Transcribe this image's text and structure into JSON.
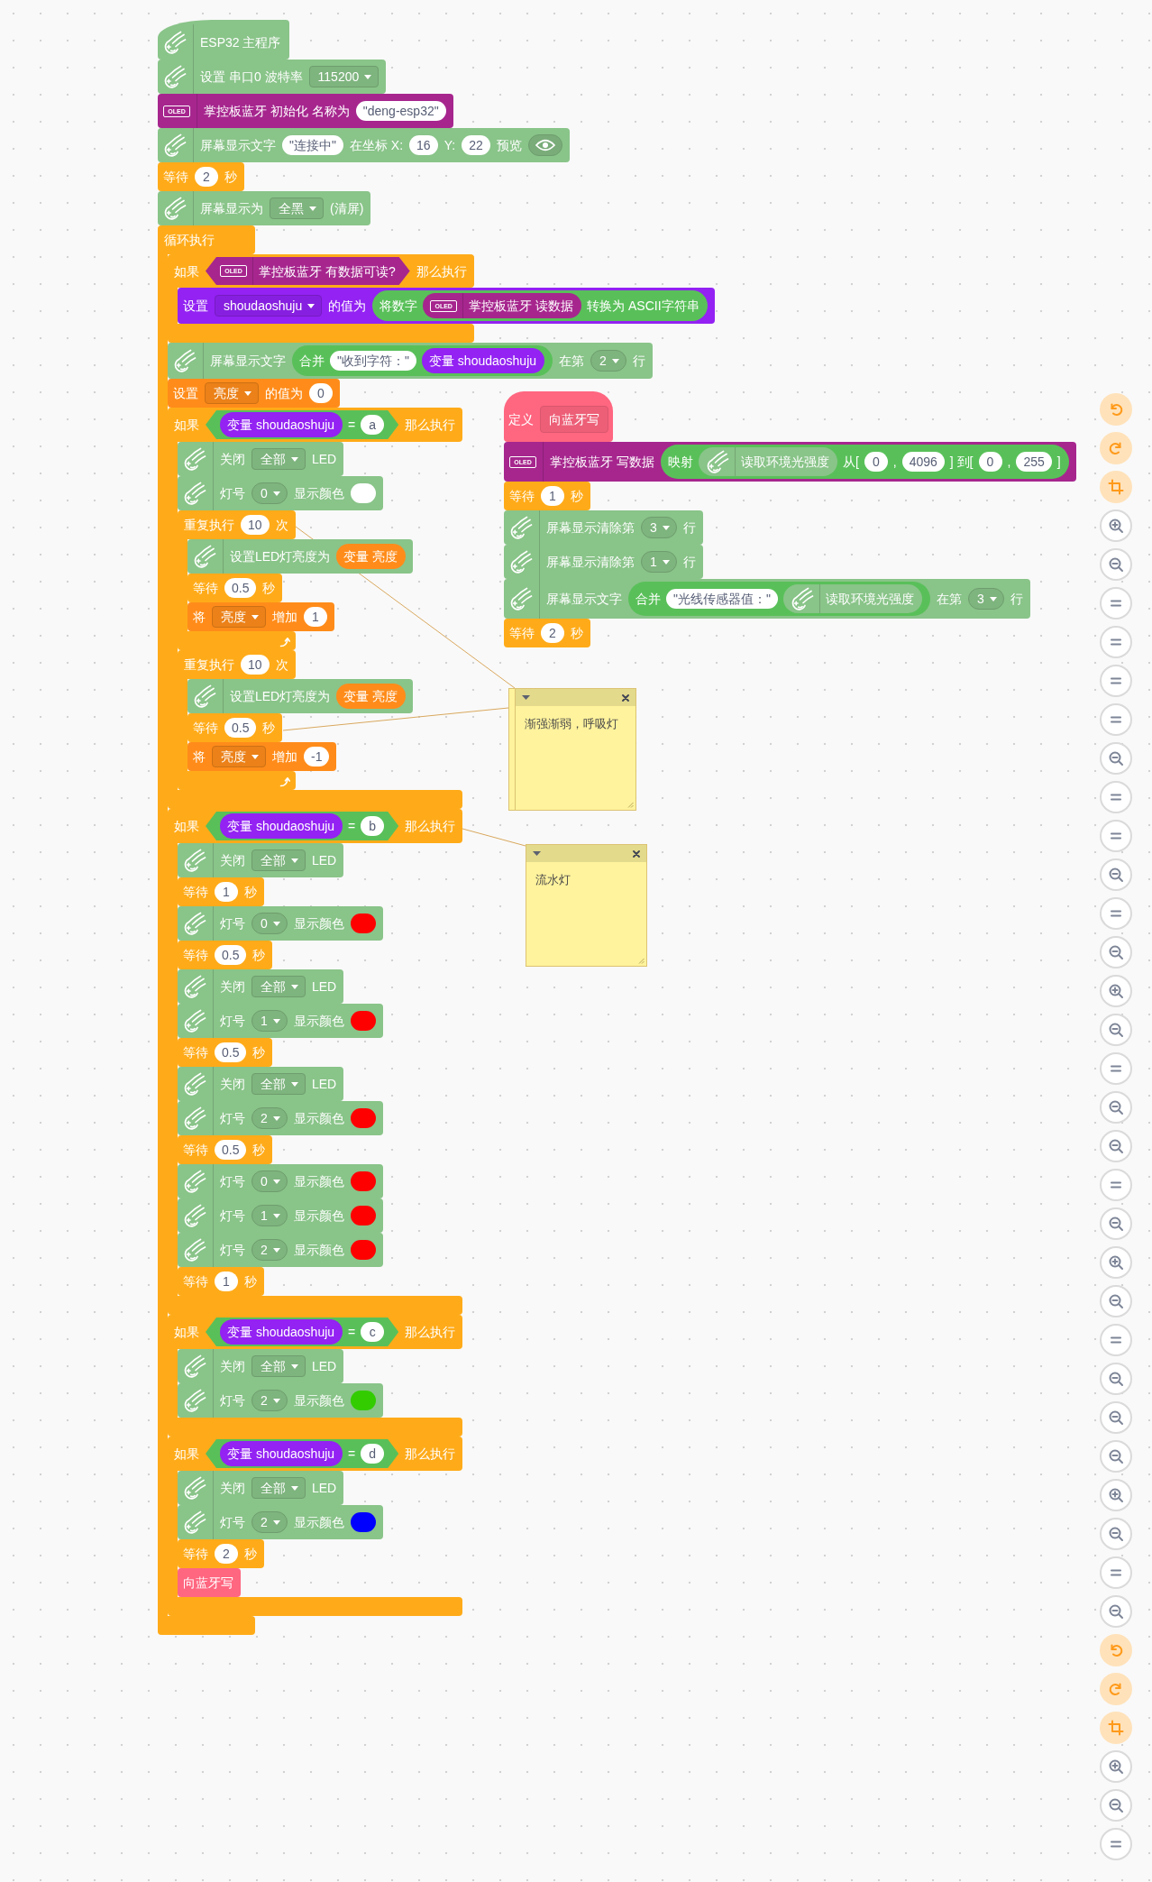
{
  "workspace": {
    "stacks": [
      {
        "blocks": [
          {
            "kind": "hat",
            "color": "#89c489",
            "parts": [
              {
                "kind": "icon"
              },
              {
                "kind": "label",
                "text": "ESP32 主程序"
              }
            ]
          },
          {
            "kind": "statement",
            "color": "#89c489",
            "parts": [
              {
                "kind": "icon"
              },
              {
                "kind": "label",
                "text": "设置 串口0 波特率"
              },
              {
                "kind": "dropdown",
                "text": "115200"
              }
            ]
          },
          {
            "kind": "statement",
            "color": "#a6268e",
            "parts": [
              {
                "kind": "tag",
                "text": "OLED"
              },
              {
                "kind": "label",
                "text": "掌控板蓝牙 初始化 名称为"
              },
              {
                "kind": "input",
                "text": "\"deng-esp32\""
              }
            ]
          },
          {
            "kind": "statement",
            "color": "#89c489",
            "parts": [
              {
                "kind": "icon"
              },
              {
                "kind": "label",
                "text": "屏幕显示文字"
              },
              {
                "kind": "input",
                "text": "\"连接中\""
              },
              {
                "kind": "label",
                "text": "在坐标 X:"
              },
              {
                "kind": "input",
                "text": "16"
              },
              {
                "kind": "label",
                "text": "Y:"
              },
              {
                "kind": "input",
                "text": "22"
              },
              {
                "kind": "label",
                "text": "预览"
              },
              {
                "kind": "eye_button"
              }
            ]
          },
          {
            "kind": "statement",
            "color": "#ffab19",
            "parts": [
              {
                "kind": "label",
                "text": "等待"
              },
              {
                "kind": "input",
                "text": "2"
              },
              {
                "kind": "label",
                "text": "秒"
              }
            ]
          },
          {
            "kind": "statement",
            "color": "#89c489",
            "parts": [
              {
                "kind": "icon"
              },
              {
                "kind": "label",
                "text": "屏幕显示为"
              },
              {
                "kind": "dropdown",
                "text": "全黑"
              },
              {
                "kind": "label",
                "text": "(清屏)"
              }
            ]
          },
          {
            "kind": "forever",
            "color": "#ffab19",
            "parts": [
              {
                "kind": "label",
                "text": "循环执行"
              }
            ],
            "body": [
              {
                "kind": "if",
                "color": "#ffab19",
                "parts": [
                  {
                    "kind": "label",
                    "text": "如果"
                  },
                  {
                    "kind": "boolean",
                    "color": "#a6268e",
                    "parts": [
                      {
                        "kind": "tag",
                        "text": "OLED"
                      },
                      {
                        "kind": "label",
                        "text": "掌控板蓝牙 有数据可读?"
                      }
                    ]
                  },
                  {
                    "kind": "label",
                    "text": "那么执行"
                  }
                ],
                "body": [
                  {
                    "kind": "statement",
                    "color": "#9322f3",
                    "parts": [
                      {
                        "kind": "label",
                        "text": "设置"
                      },
                      {
                        "kind": "dropdown",
                        "text": "shoudaoshuju"
                      },
                      {
                        "kind": "label",
                        "text": "的值为"
                      },
                      {
                        "kind": "reporter",
                        "color": "#59c059",
                        "parts": [
                          {
                            "kind": "label",
                            "text": "将数字"
                          },
                          {
                            "kind": "reporter",
                            "color": "#a6268e",
                            "parts": [
                              {
                                "kind": "tag",
                                "text": "OLED"
                              },
                              {
                                "kind": "label",
                                "text": "掌控板蓝牙 读数据"
                              }
                            ]
                          },
                          {
                            "kind": "label",
                            "text": "转换为 ASCII字符串"
                          }
                        ]
                      }
                    ]
                  }
                ]
              },
              {
                "kind": "statement",
                "color": "#89c489",
                "parts": [
                  {
                    "kind": "icon"
                  },
                  {
                    "kind": "label",
                    "text": "屏幕显示文字"
                  },
                  {
                    "kind": "reporter",
                    "color": "#59c059",
                    "parts": [
                      {
                        "kind": "label",
                        "text": "合并"
                      },
                      {
                        "kind": "input",
                        "text": "\"收到字符：\""
                      },
                      {
                        "kind": "reporter",
                        "color": "#9322f3",
                        "parts": [
                          {
                            "kind": "label",
                            "text": "变量 shoudaoshuju"
                          }
                        ]
                      }
                    ]
                  },
                  {
                    "kind": "label",
                    "text": "在第"
                  },
                  {
                    "kind": "pill_dropdown",
                    "text": "2"
                  },
                  {
                    "kind": "label",
                    "text": "行"
                  }
                ]
              },
              {
                "kind": "statement",
                "color": "#ff8c1a",
                "parts": [
                  {
                    "kind": "label",
                    "text": "设置"
                  },
                  {
                    "kind": "dropdown",
                    "text": "亮度"
                  },
                  {
                    "kind": "label",
                    "text": "的值为"
                  },
                  {
                    "kind": "input",
                    "text": "0"
                  }
                ]
              },
              {
                "kind": "if",
                "color": "#ffab19",
                "parts": [
                  {
                    "kind": "label",
                    "text": "如果"
                  },
                  {
                    "kind": "boolean",
                    "color": "#59c059",
                    "parts": [
                      {
                        "kind": "reporter",
                        "color": "#9322f3",
                        "parts": [
                          {
                            "kind": "label",
                            "text": "变量 shoudaoshuju"
                          }
                        ]
                      },
                      {
                        "kind": "label",
                        "text": "="
                      },
                      {
                        "kind": "input",
                        "text": "a"
                      }
                    ]
                  },
                  {
                    "kind": "label",
                    "text": "那么执行"
                  }
                ],
                "body": [
                  {
                    "kind": "statement",
                    "color": "#89c489",
                    "parts": [
                      {
                        "kind": "icon"
                      },
                      {
                        "kind": "label",
                        "text": "关闭"
                      },
                      {
                        "kind": "dropdown",
                        "text": "全部"
                      },
                      {
                        "kind": "label",
                        "text": "LED"
                      }
                    ]
                  },
                  {
                    "kind": "statement",
                    "color": "#89c489",
                    "parts": [
                      {
                        "kind": "icon"
                      },
                      {
                        "kind": "label",
                        "text": "灯号"
                      },
                      {
                        "kind": "pill_dropdown",
                        "text": "0"
                      },
                      {
                        "kind": "label",
                        "text": "显示颜色"
                      },
                      {
                        "kind": "swatch",
                        "color": "#ffffff"
                      }
                    ]
                  },
                  {
                    "kind": "repeat",
                    "color": "#ffab19",
                    "commented": true,
                    "parts": [
                      {
                        "kind": "label",
                        "text": "重复执行"
                      },
                      {
                        "kind": "input",
                        "text": "10"
                      },
                      {
                        "kind": "label",
                        "text": "次"
                      }
                    ],
                    "body": [
                      {
                        "kind": "statement",
                        "color": "#89c489",
                        "parts": [
                          {
                            "kind": "icon"
                          },
                          {
                            "kind": "label",
                            "text": "设置LED灯亮度为"
                          },
                          {
                            "kind": "reporter",
                            "color": "#ff8c1a",
                            "parts": [
                              {
                                "kind": "label",
                                "text": "变量 亮度"
                              }
                            ]
                          }
                        ]
                      },
                      {
                        "kind": "statement",
                        "color": "#ffab19",
                        "parts": [
                          {
                            "kind": "label",
                            "text": "等待"
                          },
                          {
                            "kind": "input",
                            "text": "0.5"
                          },
                          {
                            "kind": "label",
                            "text": "秒"
                          }
                        ]
                      },
                      {
                        "kind": "statement",
                        "color": "#ff8c1a",
                        "parts": [
                          {
                            "kind": "label",
                            "text": "将"
                          },
                          {
                            "kind": "dropdown",
                            "text": "亮度"
                          },
                          {
                            "kind": "label",
                            "text": "增加"
                          },
                          {
                            "kind": "input",
                            "text": "1"
                          }
                        ]
                      }
                    ]
                  },
                  {
                    "kind": "repeat",
                    "color": "#ffab19",
                    "parts": [
                      {
                        "kind": "label",
                        "text": "重复执行"
                      },
                      {
                        "kind": "input",
                        "text": "10"
                      },
                      {
                        "kind": "label",
                        "text": "次"
                      }
                    ],
                    "body": [
                      {
                        "kind": "statement",
                        "color": "#89c489",
                        "parts": [
                          {
                            "kind": "icon"
                          },
                          {
                            "kind": "label",
                            "text": "设置LED灯亮度为"
                          },
                          {
                            "kind": "reporter",
                            "color": "#ff8c1a",
                            "parts": [
                              {
                                "kind": "label",
                                "text": "变量 亮度"
                              }
                            ]
                          }
                        ]
                      },
                      {
                        "kind": "statement",
                        "color": "#ffab19",
                        "commented": true,
                        "parts": [
                          {
                            "kind": "label",
                            "text": "等待"
                          },
                          {
                            "kind": "input",
                            "text": "0.5"
                          },
                          {
                            "kind": "label",
                            "text": "秒"
                          }
                        ]
                      },
                      {
                        "kind": "statement",
                        "color": "#ff8c1a",
                        "parts": [
                          {
                            "kind": "label",
                            "text": "将"
                          },
                          {
                            "kind": "dropdown",
                            "text": "亮度"
                          },
                          {
                            "kind": "label",
                            "text": "增加"
                          },
                          {
                            "kind": "input",
                            "text": "-1"
                          }
                        ]
                      }
                    ]
                  }
                ]
              },
              {
                "kind": "if",
                "color": "#ffab19",
                "commented": true,
                "parts": [
                  {
                    "kind": "label",
                    "text": "如果"
                  },
                  {
                    "kind": "boolean",
                    "color": "#59c059",
                    "parts": [
                      {
                        "kind": "reporter",
                        "color": "#9322f3",
                        "parts": [
                          {
                            "kind": "label",
                            "text": "变量 shoudaoshuju"
                          }
                        ]
                      },
                      {
                        "kind": "label",
                        "text": "="
                      },
                      {
                        "kind": "input",
                        "text": "b"
                      }
                    ]
                  },
                  {
                    "kind": "label",
                    "text": "那么执行"
                  }
                ],
                "body": [
                  {
                    "kind": "statement",
                    "color": "#89c489",
                    "parts": [
                      {
                        "kind": "icon"
                      },
                      {
                        "kind": "label",
                        "text": "关闭"
                      },
                      {
                        "kind": "dropdown",
                        "text": "全部"
                      },
                      {
                        "kind": "label",
                        "text": "LED"
                      }
                    ]
                  },
                  {
                    "kind": "statement",
                    "color": "#ffab19",
                    "parts": [
                      {
                        "kind": "label",
                        "text": "等待"
                      },
                      {
                        "kind": "input",
                        "text": "1"
                      },
                      {
                        "kind": "label",
                        "text": "秒"
                      }
                    ]
                  },
                  {
                    "kind": "statement",
                    "color": "#89c489",
                    "parts": [
                      {
                        "kind": "icon"
                      },
                      {
                        "kind": "label",
                        "text": "灯号"
                      },
                      {
                        "kind": "pill_dropdown",
                        "text": "0"
                      },
                      {
                        "kind": "label",
                        "text": "显示颜色"
                      },
                      {
                        "kind": "swatch",
                        "color": "#ff0000"
                      }
                    ]
                  },
                  {
                    "kind": "statement",
                    "color": "#ffab19",
                    "parts": [
                      {
                        "kind": "label",
                        "text": "等待"
                      },
                      {
                        "kind": "input",
                        "text": "0.5"
                      },
                      {
                        "kind": "label",
                        "text": "秒"
                      }
                    ]
                  },
                  {
                    "kind": "statement",
                    "color": "#89c489",
                    "parts": [
                      {
                        "kind": "icon"
                      },
                      {
                        "kind": "label",
                        "text": "关闭"
                      },
                      {
                        "kind": "dropdown",
                        "text": "全部"
                      },
                      {
                        "kind": "label",
                        "text": "LED"
                      }
                    ]
                  },
                  {
                    "kind": "statement",
                    "color": "#89c489",
                    "parts": [
                      {
                        "kind": "icon"
                      },
                      {
                        "kind": "label",
                        "text": "灯号"
                      },
                      {
                        "kind": "pill_dropdown",
                        "text": "1"
                      },
                      {
                        "kind": "label",
                        "text": "显示颜色"
                      },
                      {
                        "kind": "swatch",
                        "color": "#ff0000"
                      }
                    ]
                  },
                  {
                    "kind": "statement",
                    "color": "#ffab19",
                    "parts": [
                      {
                        "kind": "label",
                        "text": "等待"
                      },
                      {
                        "kind": "input",
                        "text": "0.5"
                      },
                      {
                        "kind": "label",
                        "text": "秒"
                      }
                    ]
                  },
                  {
                    "kind": "statement",
                    "color": "#89c489",
                    "parts": [
                      {
                        "kind": "icon"
                      },
                      {
                        "kind": "label",
                        "text": "关闭"
                      },
                      {
                        "kind": "dropdown",
                        "text": "全部"
                      },
                      {
                        "kind": "label",
                        "text": "LED"
                      }
                    ]
                  },
                  {
                    "kind": "statement",
                    "color": "#89c489",
                    "parts": [
                      {
                        "kind": "icon"
                      },
                      {
                        "kind": "label",
                        "text": "灯号"
                      },
                      {
                        "kind": "pill_dropdown",
                        "text": "2"
                      },
                      {
                        "kind": "label",
                        "text": "显示颜色"
                      },
                      {
                        "kind": "swatch",
                        "color": "#ff0000"
                      }
                    ]
                  },
                  {
                    "kind": "statement",
                    "color": "#ffab19",
                    "parts": [
                      {
                        "kind": "label",
                        "text": "等待"
                      },
                      {
                        "kind": "input",
                        "text": "0.5"
                      },
                      {
                        "kind": "label",
                        "text": "秒"
                      }
                    ]
                  },
                  {
                    "kind": "statement",
                    "color": "#89c489",
                    "parts": [
                      {
                        "kind": "icon"
                      },
                      {
                        "kind": "label",
                        "text": "灯号"
                      },
                      {
                        "kind": "pill_dropdown",
                        "text": "0"
                      },
                      {
                        "kind": "label",
                        "text": "显示颜色"
                      },
                      {
                        "kind": "swatch",
                        "color": "#ff0000"
                      }
                    ]
                  },
                  {
                    "kind": "statement",
                    "color": "#89c489",
                    "parts": [
                      {
                        "kind": "icon"
                      },
                      {
                        "kind": "label",
                        "text": "灯号"
                      },
                      {
                        "kind": "pill_dropdown",
                        "text": "1"
                      },
                      {
                        "kind": "label",
                        "text": "显示颜色"
                      },
                      {
                        "kind": "swatch",
                        "color": "#ff0000"
                      }
                    ]
                  },
                  {
                    "kind": "statement",
                    "color": "#89c489",
                    "parts": [
                      {
                        "kind": "icon"
                      },
                      {
                        "kind": "label",
                        "text": "灯号"
                      },
                      {
                        "kind": "pill_dropdown",
                        "text": "2"
                      },
                      {
                        "kind": "label",
                        "text": "显示颜色"
                      },
                      {
                        "kind": "swatch",
                        "color": "#ff0000"
                      }
                    ]
                  },
                  {
                    "kind": "statement",
                    "color": "#ffab19",
                    "parts": [
                      {
                        "kind": "label",
                        "text": "等待"
                      },
                      {
                        "kind": "input",
                        "text": "1"
                      },
                      {
                        "kind": "label",
                        "text": "秒"
                      }
                    ]
                  }
                ]
              },
              {
                "kind": "if",
                "color": "#ffab19",
                "parts": [
                  {
                    "kind": "label",
                    "text": "如果"
                  },
                  {
                    "kind": "boolean",
                    "color": "#59c059",
                    "parts": [
                      {
                        "kind": "reporter",
                        "color": "#9322f3",
                        "parts": [
                          {
                            "kind": "label",
                            "text": "变量 shoudaoshuju"
                          }
                        ]
                      },
                      {
                        "kind": "label",
                        "text": "="
                      },
                      {
                        "kind": "input",
                        "text": "c"
                      }
                    ]
                  },
                  {
                    "kind": "label",
                    "text": "那么执行"
                  }
                ],
                "body": [
                  {
                    "kind": "statement",
                    "color": "#89c489",
                    "parts": [
                      {
                        "kind": "icon"
                      },
                      {
                        "kind": "label",
                        "text": "关闭"
                      },
                      {
                        "kind": "dropdown",
                        "text": "全部"
                      },
                      {
                        "kind": "label",
                        "text": "LED"
                      }
                    ]
                  },
                  {
                    "kind": "statement",
                    "color": "#89c489",
                    "parts": [
                      {
                        "kind": "icon"
                      },
                      {
                        "kind": "label",
                        "text": "灯号"
                      },
                      {
                        "kind": "pill_dropdown",
                        "text": "2"
                      },
                      {
                        "kind": "label",
                        "text": "显示颜色"
                      },
                      {
                        "kind": "swatch",
                        "color": "#33cc00"
                      }
                    ]
                  }
                ]
              },
              {
                "kind": "if",
                "color": "#ffab19",
                "parts": [
                  {
                    "kind": "label",
                    "text": "如果"
                  },
                  {
                    "kind": "boolean",
                    "color": "#59c059",
                    "parts": [
                      {
                        "kind": "reporter",
                        "color": "#9322f3",
                        "parts": [
                          {
                            "kind": "label",
                            "text": "变量 shoudaoshuju"
                          }
                        ]
                      },
                      {
                        "kind": "label",
                        "text": "="
                      },
                      {
                        "kind": "input",
                        "text": "d"
                      }
                    ]
                  },
                  {
                    "kind": "label",
                    "text": "那么执行"
                  }
                ],
                "body": [
                  {
                    "kind": "statement",
                    "color": "#89c489",
                    "parts": [
                      {
                        "kind": "icon"
                      },
                      {
                        "kind": "label",
                        "text": "关闭"
                      },
                      {
                        "kind": "dropdown",
                        "text": "全部"
                      },
                      {
                        "kind": "label",
                        "text": "LED"
                      }
                    ]
                  },
                  {
                    "kind": "statement",
                    "color": "#89c489",
                    "parts": [
                      {
                        "kind": "icon"
                      },
                      {
                        "kind": "label",
                        "text": "灯号"
                      },
                      {
                        "kind": "pill_dropdown",
                        "text": "2"
                      },
                      {
                        "kind": "label",
                        "text": "显示颜色"
                      },
                      {
                        "kind": "swatch",
                        "color": "#0000ff"
                      }
                    ]
                  },
                  {
                    "kind": "statement",
                    "color": "#ffab19",
                    "parts": [
                      {
                        "kind": "label",
                        "text": "等待"
                      },
                      {
                        "kind": "input",
                        "text": "2"
                      },
                      {
                        "kind": "label",
                        "text": "秒"
                      }
                    ]
                  },
                  {
                    "kind": "statement",
                    "color": "#ff6680",
                    "parts": [
                      {
                        "kind": "label",
                        "text": "向蓝牙写"
                      }
                    ]
                  }
                ]
              }
            ]
          }
        ]
      },
      {
        "blocks": [
          {
            "kind": "define",
            "color": "#ff6680",
            "parts": [
              {
                "kind": "label",
                "text": "定义"
              },
              {
                "kind": "prototype",
                "text": "向蓝牙写"
              }
            ]
          },
          {
            "kind": "statement",
            "color": "#a6268e",
            "parts": [
              {
                "kind": "tag",
                "text": "OLED"
              },
              {
                "kind": "label",
                "text": "掌控板蓝牙 写数据"
              },
              {
                "kind": "reporter",
                "color": "#59c059",
                "parts": [
                  {
                    "kind": "label",
                    "text": "映射"
                  },
                  {
                    "kind": "reporter",
                    "color": "#89c489",
                    "parts": [
                      {
                        "kind": "icon"
                      },
                      {
                        "kind": "label",
                        "text": "读取环境光强度"
                      }
                    ]
                  },
                  {
                    "kind": "label",
                    "text": "从["
                  },
                  {
                    "kind": "input",
                    "text": "0"
                  },
                  {
                    "kind": "label",
                    "text": ","
                  },
                  {
                    "kind": "input",
                    "text": "4096"
                  },
                  {
                    "kind": "label",
                    "text": "] 到["
                  },
                  {
                    "kind": "input",
                    "text": "0"
                  },
                  {
                    "kind": "label",
                    "text": ","
                  },
                  {
                    "kind": "input",
                    "text": "255"
                  },
                  {
                    "kind": "label",
                    "text": "]"
                  }
                ]
              }
            ]
          },
          {
            "kind": "statement",
            "color": "#ffab19",
            "parts": [
              {
                "kind": "label",
                "text": "等待"
              },
              {
                "kind": "input",
                "text": "1"
              },
              {
                "kind": "label",
                "text": "秒"
              }
            ]
          },
          {
            "kind": "statement",
            "color": "#89c489",
            "parts": [
              {
                "kind": "icon"
              },
              {
                "kind": "label",
                "text": "屏幕显示清除第"
              },
              {
                "kind": "pill_dropdown",
                "text": "3"
              },
              {
                "kind": "label",
                "text": "行"
              }
            ]
          },
          {
            "kind": "statement",
            "color": "#89c489",
            "parts": [
              {
                "kind": "icon"
              },
              {
                "kind": "label",
                "text": "屏幕显示清除第"
              },
              {
                "kind": "pill_dropdown",
                "text": "1"
              },
              {
                "kind": "label",
                "text": "行"
              }
            ]
          },
          {
            "kind": "statement",
            "color": "#89c489",
            "parts": [
              {
                "kind": "icon"
              },
              {
                "kind": "label",
                "text": "屏幕显示文字"
              },
              {
                "kind": "reporter",
                "color": "#59c059",
                "parts": [
                  {
                    "kind": "label",
                    "text": "合并"
                  },
                  {
                    "kind": "input",
                    "text": "\"光线传感器值：\""
                  },
                  {
                    "kind": "reporter",
                    "color": "#89c489",
                    "parts": [
                      {
                        "kind": "icon"
                      },
                      {
                        "kind": "label",
                        "text": "读取环境光强度"
                      }
                    ]
                  }
                ]
              },
              {
                "kind": "label",
                "text": "在第"
              },
              {
                "kind": "pill_dropdown",
                "text": "3"
              },
              {
                "kind": "label",
                "text": "行"
              }
            ]
          },
          {
            "kind": "statement",
            "color": "#ffab19",
            "parts": [
              {
                "kind": "label",
                "text": "等待"
              },
              {
                "kind": "input",
                "text": "2"
              },
              {
                "kind": "label",
                "text": "秒"
              }
            ]
          }
        ]
      }
    ],
    "comments": [
      {
        "kind": "double",
        "text": "渐强渐弱，呼吸灯"
      },
      {
        "kind": "single",
        "text": "流水灯"
      }
    ]
  },
  "toolbar": [
    {
      "kind": "undo"
    },
    {
      "kind": "redo"
    },
    {
      "kind": "crop"
    },
    {
      "kind": "zoom-in"
    },
    {
      "kind": "zoom-out"
    },
    {
      "kind": "reset"
    },
    {
      "kind": "reset"
    },
    {
      "kind": "reset"
    },
    {
      "kind": "reset"
    },
    {
      "kind": "zoom-out"
    },
    {
      "kind": "reset"
    },
    {
      "kind": "reset"
    },
    {
      "kind": "zoom-out"
    },
    {
      "kind": "reset"
    },
    {
      "kind": "zoom-out"
    },
    {
      "kind": "zoom-in"
    },
    {
      "kind": "zoom-out"
    },
    {
      "kind": "reset"
    },
    {
      "kind": "zoom-out"
    },
    {
      "kind": "zoom-out"
    },
    {
      "kind": "reset"
    },
    {
      "kind": "zoom-out"
    },
    {
      "kind": "zoom-in"
    },
    {
      "kind": "zoom-out"
    },
    {
      "kind": "reset"
    },
    {
      "kind": "zoom-out"
    },
    {
      "kind": "zoom-out"
    },
    {
      "kind": "zoom-out"
    },
    {
      "kind": "zoom-in"
    },
    {
      "kind": "zoom-out"
    },
    {
      "kind": "reset"
    },
    {
      "kind": "zoom-out"
    },
    {
      "kind": "undo"
    },
    {
      "kind": "redo"
    },
    {
      "kind": "crop"
    },
    {
      "kind": "zoom-in"
    },
    {
      "kind": "zoom-out"
    },
    {
      "kind": "reset"
    }
  ]
}
